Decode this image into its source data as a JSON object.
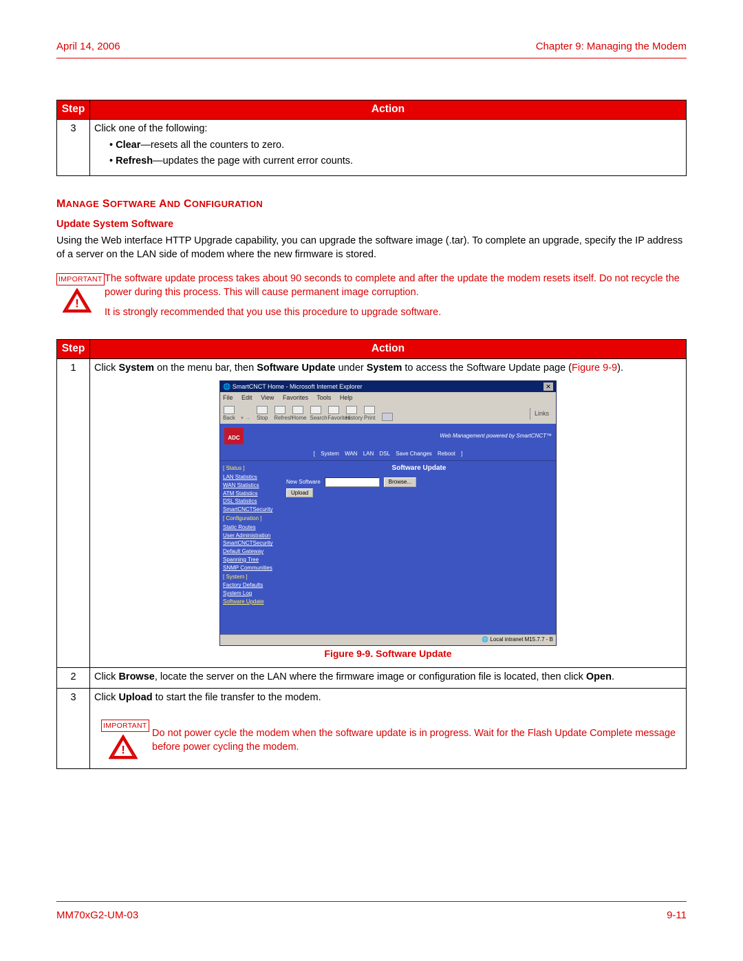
{
  "header": {
    "date": "April 14, 2006",
    "chapter": "Chapter 9: Managing the Modem"
  },
  "footer": {
    "doc": "MM70xG2-UM-03",
    "page": "9-11"
  },
  "table1": {
    "head_step": "Step",
    "head_action": "Action",
    "row": {
      "num": "3",
      "lead": "Click one of the following:",
      "b1_bold": "Clear",
      "b1_rest": "—resets all the counters to zero.",
      "b2_bold": "Refresh",
      "b2_rest": "—updates the page with current error counts."
    }
  },
  "section": {
    "heading": "Manage Software And Configuration",
    "subhead": "Update System Software",
    "para": "Using the Web interface HTTP Upgrade capability, you can upgrade the software image (.tar). To complete an upgrade, specify the IP address of a server on the LAN side of modem where the new firmware is stored."
  },
  "important1": {
    "label": "IMPORTANT",
    "p1": "The software update process takes about 90 seconds to complete and after the update the modem resets itself. Do not recycle the power during this process. This will cause permanent image corruption.",
    "p2": "It is strongly recommended that you use this procedure to upgrade software."
  },
  "table2": {
    "head_step": "Step",
    "head_action": "Action",
    "r1": {
      "num": "1",
      "pre": "Click ",
      "b1": "System",
      "mid1": " on the menu bar, then ",
      "b2": "Software Update",
      "mid2": " under ",
      "b3": "System",
      "mid3": " to access the Software Update page (",
      "figref": "Figure 9-9",
      "end": ")."
    },
    "figcap": "Figure 9-9. Software Update",
    "r2": {
      "num": "2",
      "pre": "Click ",
      "b1": "Browse",
      "mid": ", locate the server on the LAN where the firmware image or configuration file is located, then click ",
      "b2": "Open",
      "end": "."
    },
    "r3": {
      "num": "3",
      "pre": "Click ",
      "b1": "Upload",
      "rest": " to start the file transfer to the modem."
    }
  },
  "important2": {
    "label": "IMPORTANT",
    "text": "Do not power cycle the modem when the software update is in progress. Wait for the Flash Update Complete  message before power cycling the modem."
  },
  "shot": {
    "title": "SmartCNCT Home - Microsoft Internet Explorer",
    "menu": {
      "file": "File",
      "edit": "Edit",
      "view": "View",
      "fav": "Favorites",
      "tools": "Tools",
      "help": "Help"
    },
    "tool": {
      "back": "Back",
      "stop": "Stop",
      "refresh": "Refresh",
      "home": "Home",
      "search": "Search",
      "favorites": "Favorites",
      "history": "History",
      "print": "Print"
    },
    "links": "Links",
    "logo": "ADC",
    "tag": "Web Management powered by SmartCNCT™",
    "tabs": {
      "open": "[ ",
      "system": "System",
      "wan": "WAN",
      "lan": "LAN",
      "dsl": "DSL",
      "save": "Save Changes",
      "reboot": "Reboot",
      "close": " ]"
    },
    "side": {
      "status": "[ Status ]",
      "lanstat": "LAN Statistics",
      "wanstat": "WAN Statistics",
      "atmstat": "ATM Statistics",
      "dslstat": "DSL Statistics",
      "sec1": "SmartCNCTSecurity",
      "config": "[ Configuration ]",
      "routes": "Static Routes",
      "useradmin": "User Administration",
      "sec2": "SmartCNCTSecurity",
      "defgw": "Default Gateway",
      "span": "Spanning Tree",
      "snmp": "SNMP Communities",
      "system": "[ System ]",
      "factory": "Factory Defaults",
      "syslog": "System Log",
      "swup": "Software Update"
    },
    "panel": {
      "title": "Software Update",
      "label": "New Software",
      "browse": "Browse...",
      "upload": "Upload"
    },
    "status": "Local intranet  M15.7.7 - B"
  }
}
